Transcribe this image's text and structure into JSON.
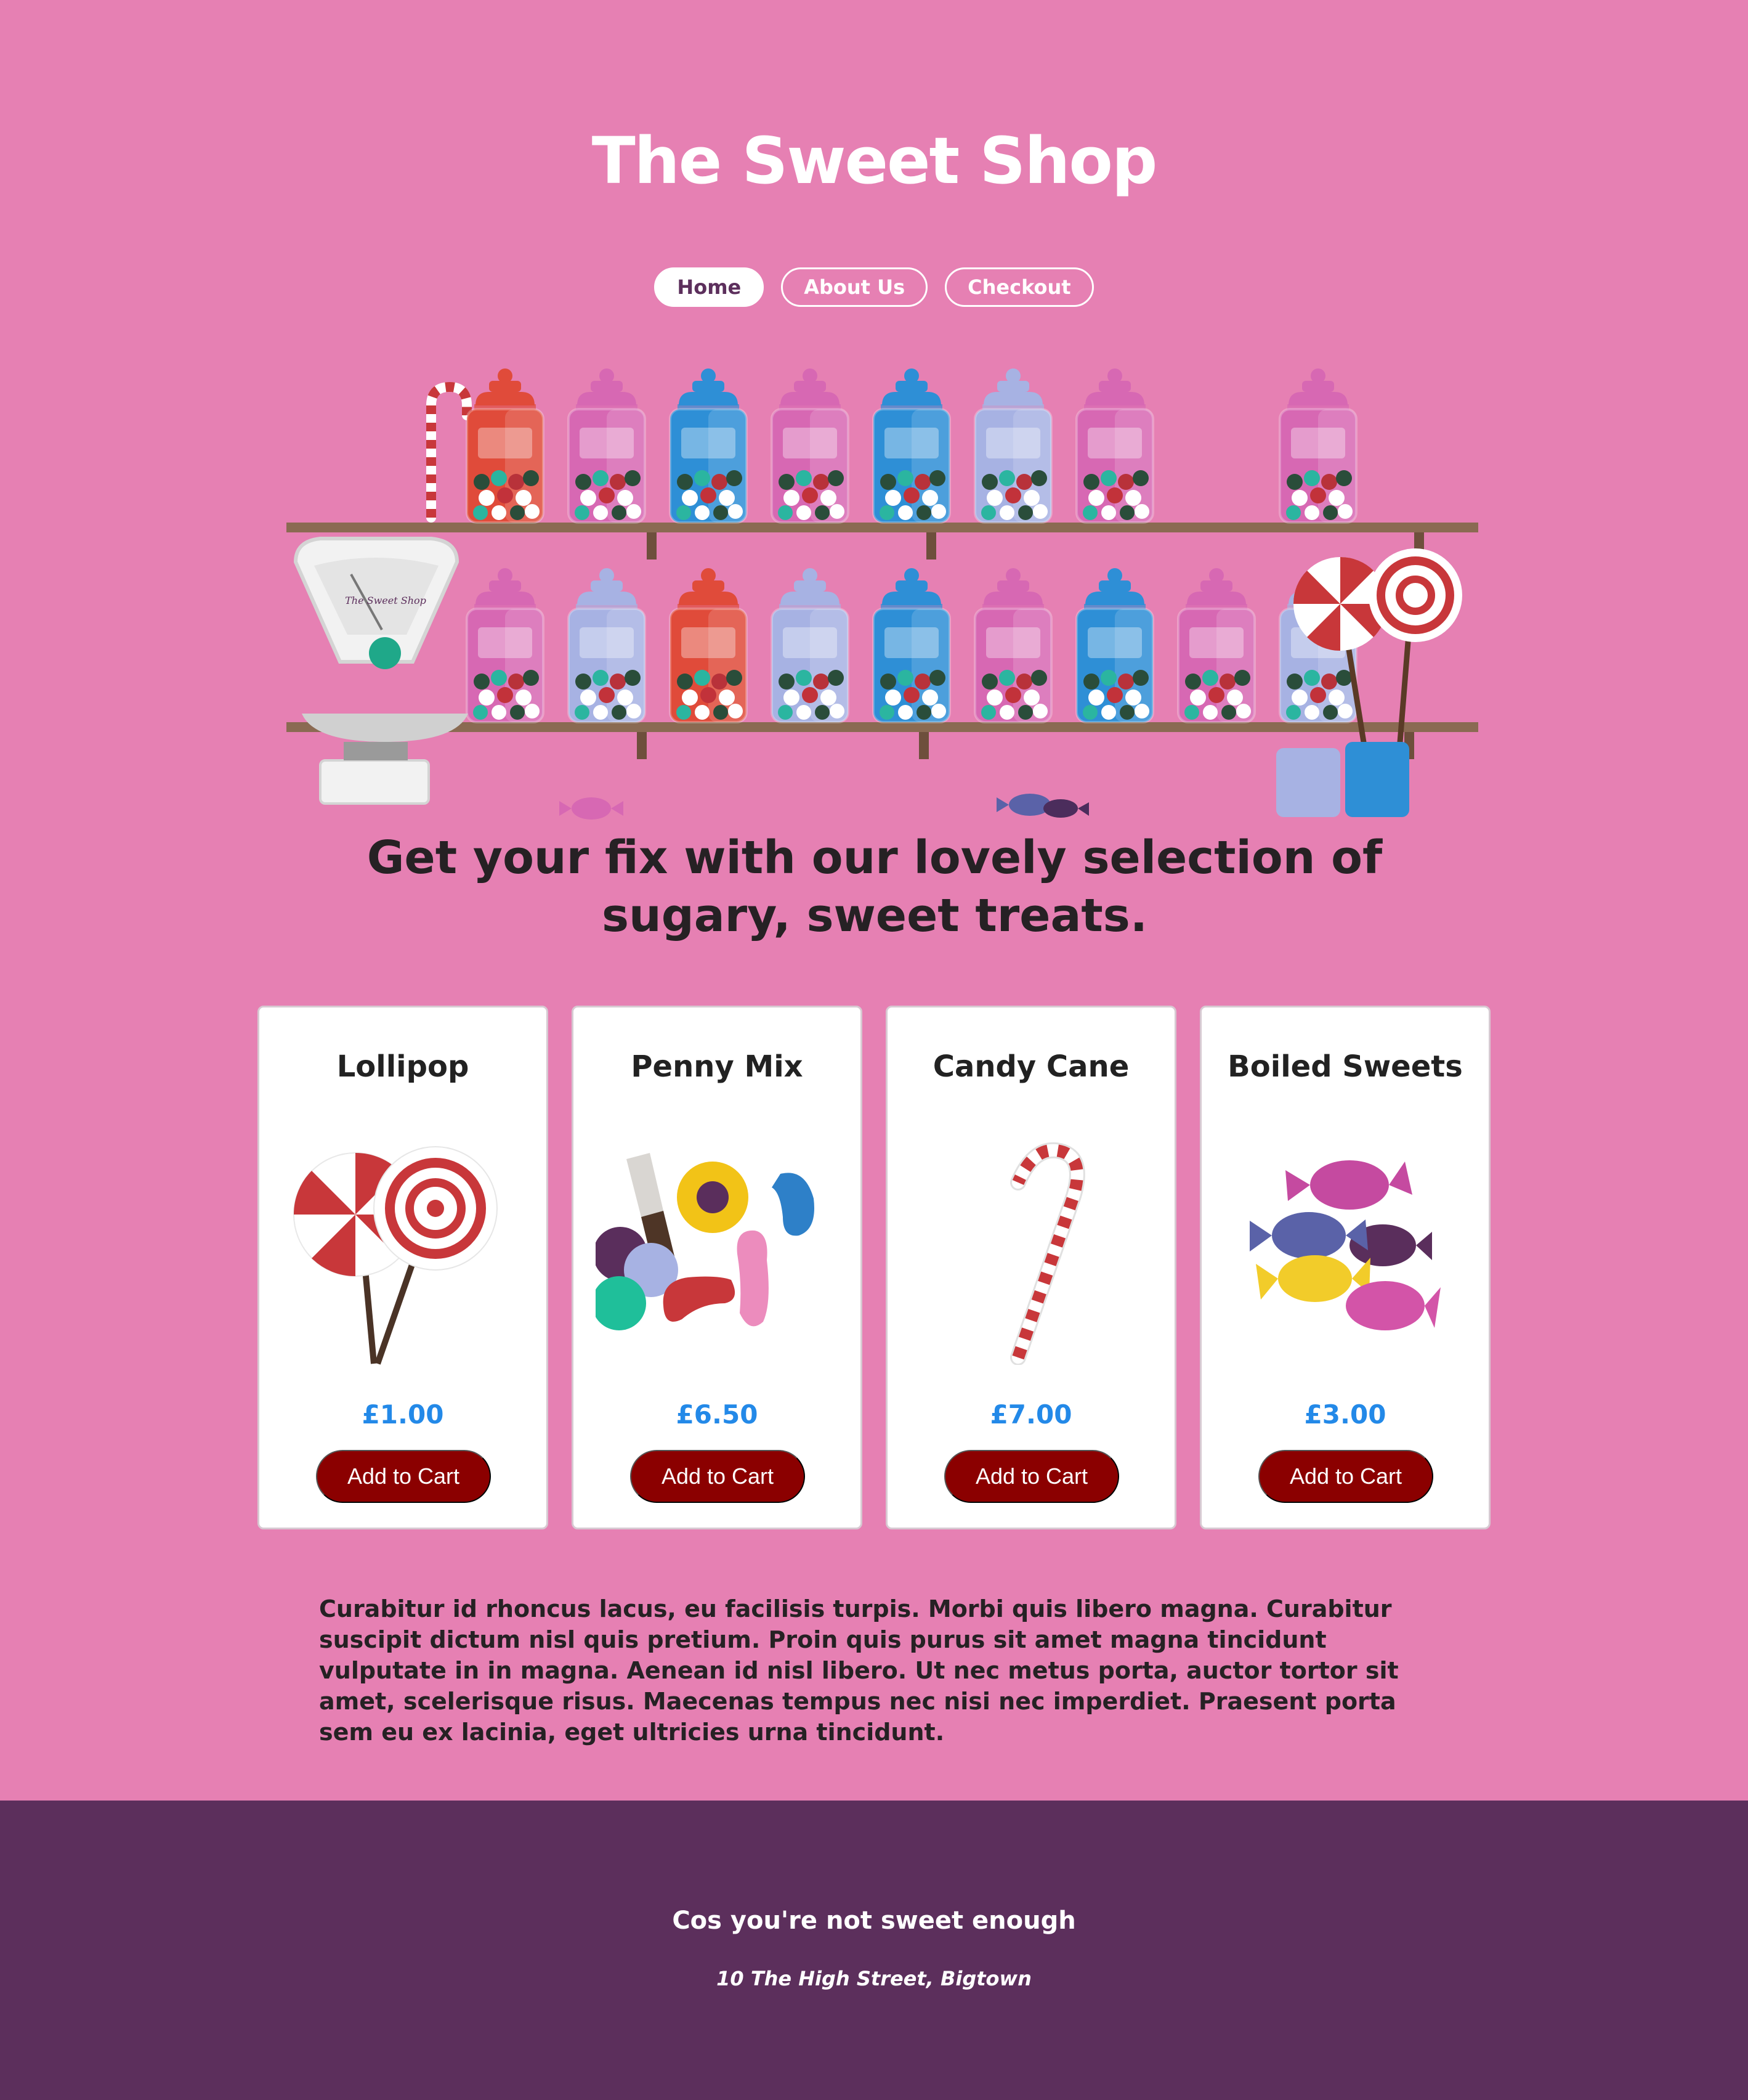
{
  "site": {
    "title": "The Sweet Shop"
  },
  "nav": {
    "items": [
      {
        "label": "Home"
      },
      {
        "label": "About Us"
      },
      {
        "label": "Checkout"
      }
    ]
  },
  "hero": {
    "tagline": "Get your fix with our lovely selection of sugary, sweet treats.",
    "scale_label": "The Sweet Shop"
  },
  "products": [
    {
      "name": "Lollipop",
      "price": "£1.00",
      "button": "Add to Cart",
      "icon": "lollipop-icon"
    },
    {
      "name": "Penny Mix",
      "price": "£6.50",
      "button": "Add to Cart",
      "icon": "penny-mix-icon"
    },
    {
      "name": "Candy Cane",
      "price": "£7.00",
      "button": "Add to Cart",
      "icon": "candy-cane-icon"
    },
    {
      "name": "Boiled Sweets",
      "price": "£3.00",
      "button": "Add to Cart",
      "icon": "boiled-sweets-icon"
    }
  ],
  "content": {
    "paragraph": "Curabitur id rhoncus lacus, eu facilisis turpis. Morbi quis libero magna. Curabitur suscipit dictum nisl quis pretium. Proin quis purus sit amet magna tincidunt vulputate in in magna. Aenean id nisl libero. Ut nec metus porta, auctor tortor sit amet, scelerisque risus. Maecenas tempus nec nisi nec imperdiet. Praesent porta sem eu ex lacinia, eget ultricies urna tincidunt."
  },
  "footer": {
    "tagline": "Cos you're not sweet enough",
    "address": "10 The High Street, Bigtown"
  },
  "colors": {
    "background": "#e680b3",
    "footer": "#5c2f5c",
    "button": "#8b0000",
    "price": "#2389e8"
  }
}
